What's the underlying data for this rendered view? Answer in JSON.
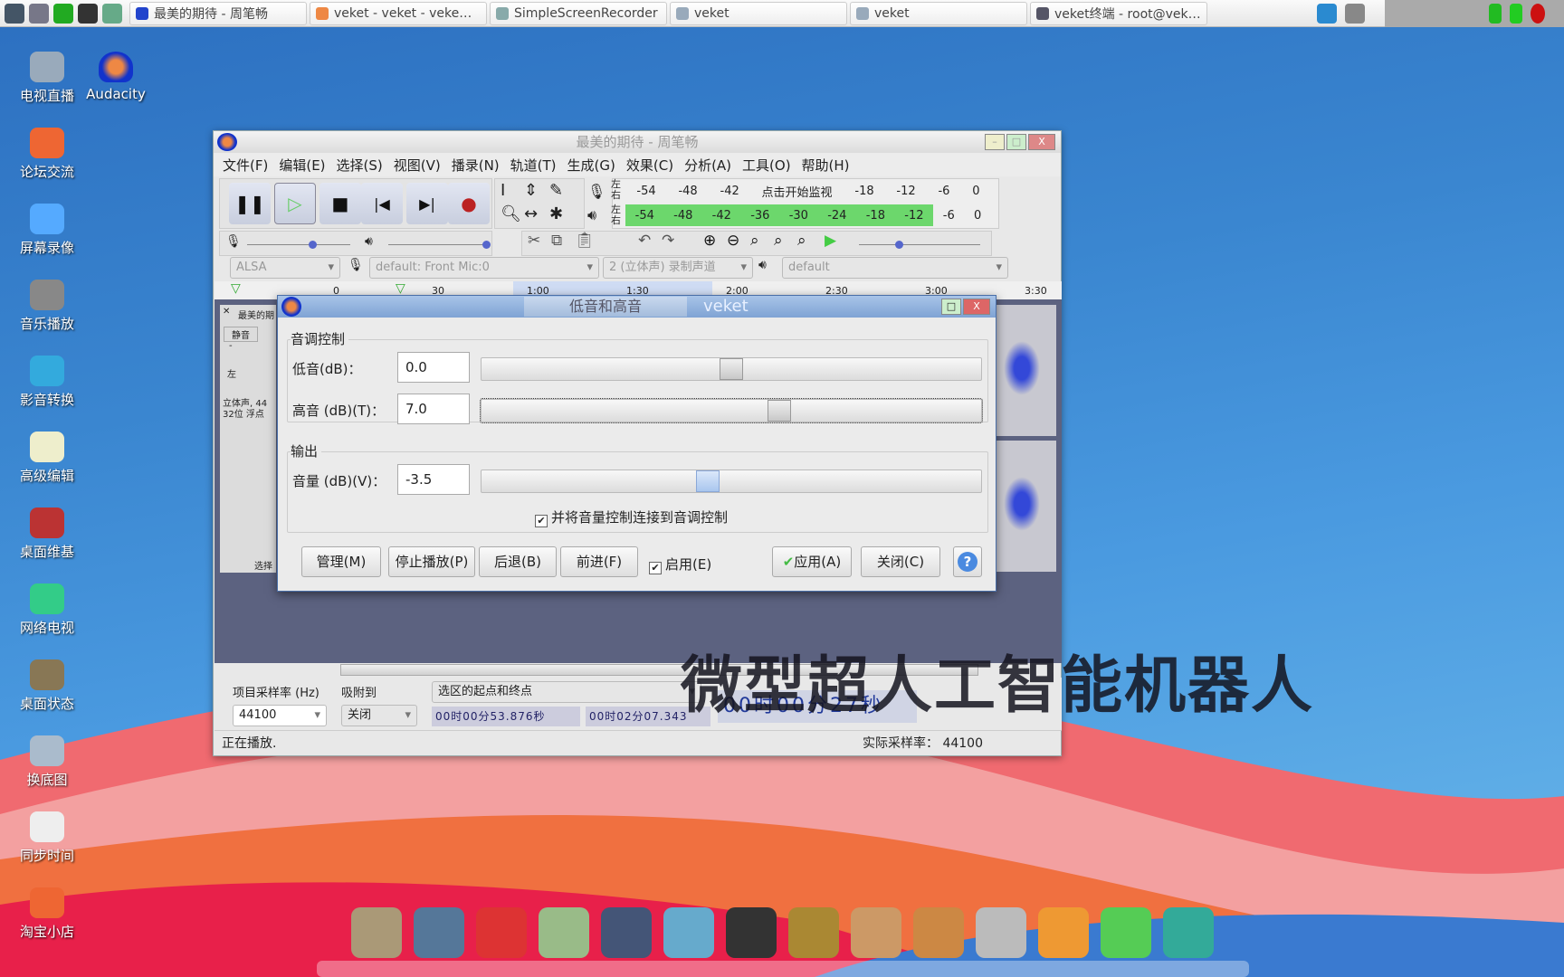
{
  "taskbar": {
    "tasks": [
      "最美的期待 - 周笔畅",
      "veket - veket - veke…",
      "SimpleScreenRecorder",
      "veket",
      "veket",
      "veket终端 - root@vek…"
    ]
  },
  "desktop": {
    "icons": [
      "电视直播",
      "论坛交流",
      "屏幕录像",
      "音乐播放",
      "影音转换",
      "高级编辑",
      "桌面维基",
      "网络电视",
      "桌面状态",
      "换底图",
      "同步时间",
      "淘宝小店"
    ],
    "audacity": "Audacity"
  },
  "audacity": {
    "title": "最美的期待 - 周笔畅",
    "menu": [
      "文件(F)",
      "编辑(E)",
      "选择(S)",
      "视图(V)",
      "播录(N)",
      "轨道(T)",
      "生成(G)",
      "效果(C)",
      "分析(A)",
      "工具(O)",
      "帮助(H)"
    ],
    "meter_lr": [
      "左",
      "右"
    ],
    "rec_meter": [
      "-54",
      "-48",
      "-42",
      "点击开始监视",
      "-18",
      "-12",
      "-6",
      "0"
    ],
    "play_meter": [
      "-54",
      "-48",
      "-42",
      "-36",
      "-30",
      "-24",
      "-18",
      "-12",
      "-6",
      "0"
    ],
    "play_meter_level": 0.83,
    "host": "ALSA",
    "rec_device": "default: Front Mic:0",
    "channels": "2 (立体声) 录制声道",
    "play_device": "default",
    "ruler": [
      "0",
      "30",
      "1:00",
      "1:30",
      "2:00",
      "2:30",
      "3:00",
      "3:30"
    ],
    "track": {
      "name": "最美的期",
      "mute": "静音",
      "minus": "-",
      "left": "左",
      "info1": "立体声, 44",
      "info2": "32位 浮点",
      "select": "选择"
    },
    "selection": {
      "rate_label": "项目采样率 (Hz)",
      "snap_label": "吸附到",
      "rate": "44100",
      "snap": "关闭",
      "mode": "选区的起点和终点",
      "start": "00时00分53.876秒",
      "end": "00时02分07.343",
      "time": "00时00分27秒"
    },
    "status": "正在播放.",
    "actual_rate": "实际采样率： 44100"
  },
  "dialog": {
    "title": "低音和高音",
    "title2": "veket",
    "tone_group": "音调控制",
    "bass_label": "低音(dB)：",
    "bass": "0.0",
    "bass_level": 0.5,
    "treble_label": "高音 (dB)(T)：",
    "treble": "7.0",
    "treble_level": 0.6,
    "output_group": "输出",
    "volume_label": "音量 (dB)(V)：",
    "volume": "-3.5",
    "volume_level": 0.45,
    "link": "并将音量控制连接到音调控制",
    "buttons": {
      "manage": "管理(M)",
      "stop": "停止播放(P)",
      "back": "后退(B)",
      "forward": "前进(F)",
      "enable": "启用(E)",
      "apply": "应用(A)",
      "close": "关闭(C)",
      "help": "?"
    }
  },
  "watermark": "微型超人工智能机器人"
}
